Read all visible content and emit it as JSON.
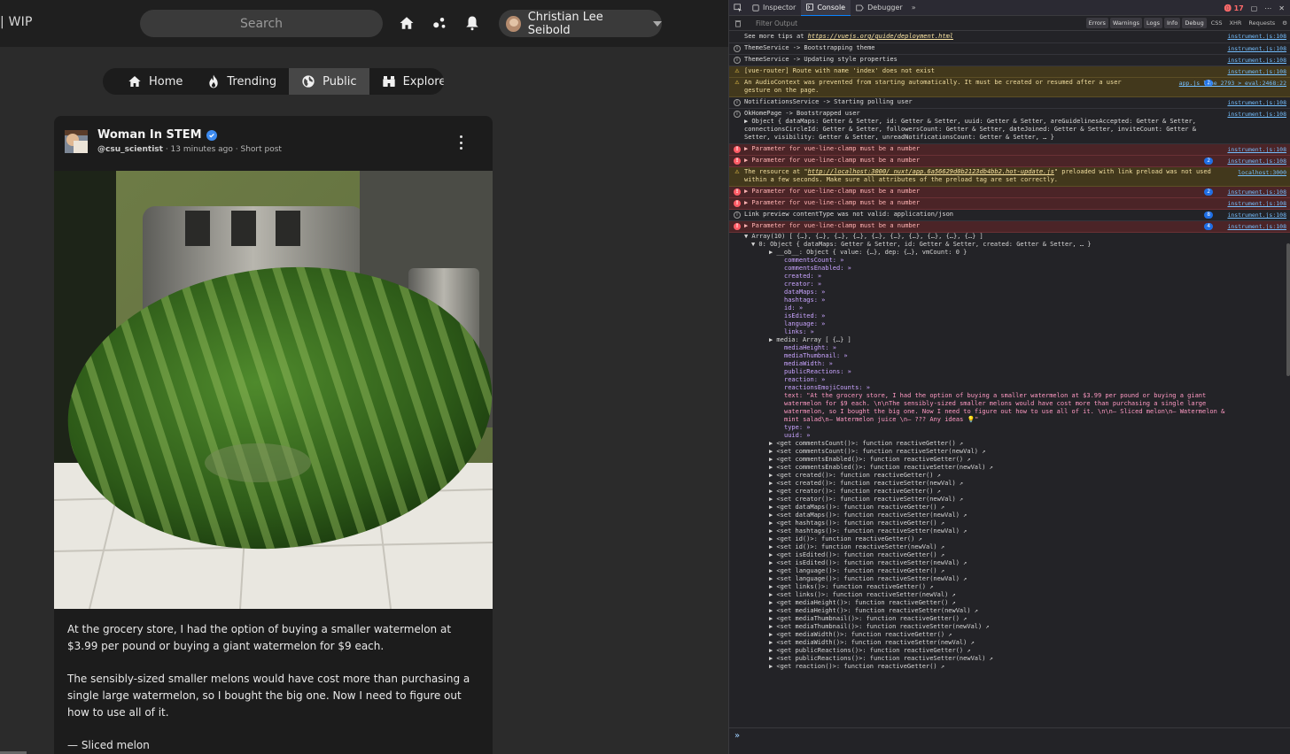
{
  "app": {
    "brand": "| WIP",
    "search": {
      "placeholder": "Search"
    },
    "user": {
      "name": "Christian Lee Seibold"
    },
    "tabs": [
      {
        "label": "Home",
        "icon": "home-icon",
        "active": false
      },
      {
        "label": "Trending",
        "icon": "flame-icon",
        "active": false
      },
      {
        "label": "Public",
        "icon": "globe-icon",
        "active": true
      },
      {
        "label": "Explore",
        "icon": "binoculars-icon",
        "active": false
      }
    ],
    "post": {
      "author": "Woman In STEM",
      "handle": "@csu_scientist",
      "time": "13 minutes ago",
      "post_type": "Short post",
      "paragraphs": [
        "At the grocery store, I had the option of buying a smaller watermelon at $3.99 per pound or buying a giant watermelon for $9 each.",
        "The sensibly-sized smaller melons would have cost more than purchasing a single large watermelon, so I bought the big one. Now I need to figure out how to use all of it.",
        "— Sliced melon"
      ]
    }
  },
  "devtools": {
    "tabs": [
      "Inspector",
      "Console",
      "Debugger"
    ],
    "error_count": "17",
    "filter_placeholder": "Filter Output",
    "filters": [
      "Errors",
      "Warnings",
      "Logs",
      "Info",
      "Debug",
      "CSS",
      "XHR",
      "Requests"
    ],
    "logs": [
      {
        "level": "plain",
        "pre": "See more tips at ",
        "link": "https://vuejs.org/guide/deployment.html",
        "post": "",
        "source": ""
      },
      {
        "level": "info",
        "text": "ThemeService -> Bootstrapping theme",
        "source": "instrument.js:108"
      },
      {
        "level": "info",
        "text": "ThemeService -> Updating style properties",
        "source": "instrument.js:108"
      },
      {
        "level": "warn",
        "text": "[vue-router] Route with name 'index' does not exist",
        "source": "instrument.js:108"
      },
      {
        "level": "warn",
        "text": "An AudioContext was prevented from starting automatically. It must be created or resumed after a user\ngesture on the page.",
        "count": "2",
        "source": "app.js line 2793 > eval:2468:22"
      },
      {
        "level": "info",
        "text": "NotificationsService -> Starting polling user",
        "source": "instrument.js:108"
      },
      {
        "level": "info",
        "text": "OkHomePage -> Bootstrapped user\n▶ Object { dataMaps: Getter & Setter, id: Getter & Setter, uuid: Getter & Setter, areGuidelinesAccepted: Getter & Setter,\nconnectionsCircleId: Getter & Setter, followersCount: Getter & Setter, dateJoined: Getter & Setter, inviteCount: Getter &\nSetter, visibility: Getter & Setter, unreadNotificationsCount: Getter & Setter, … }",
        "source": "instrument.js:108"
      },
      {
        "level": "err",
        "text": "▶ Parameter for vue-line-clamp must be a number",
        "source": "instrument.js:108"
      },
      {
        "level": "err",
        "text": "▶ Parameter for vue-line-clamp must be a number",
        "count": "2",
        "source": "instrument.js:108"
      },
      {
        "level": "warn",
        "pre": "The resource at \"",
        "link": "http://localhost:3000/_nuxt/app.6a56629d0b2123db4bb2.hot-update.js",
        "post": "\" preloaded with link preload was not used\nwithin a few seconds. Make sure all attributes of the preload tag are set correctly.",
        "source": "localhost:3000"
      },
      {
        "level": "err",
        "text": "▶ Parameter for vue-line-clamp must be a number",
        "count": "2",
        "source": "instrument.js:108"
      },
      {
        "level": "err",
        "text": "▶ Parameter for vue-line-clamp must be a number",
        "source": "instrument.js:108"
      },
      {
        "level": "info",
        "text": "Link preview contentType was not valid: application/json",
        "count": "8",
        "source": "instrument.js:108"
      },
      {
        "level": "err",
        "text": "▶ Parameter for vue-line-clamp must be a number",
        "count": "4",
        "source": "instrument.js:108"
      }
    ],
    "tree_source": "instrument.js:108",
    "tree": [
      {
        "lvl": 0,
        "text": "▼ Array(10) [ {…}, {…}, {…}, {…}, {…}, {…}, {…}, {…}, {…}, {…} ]"
      },
      {
        "lvl": 1,
        "text": "▼ 0: Object { dataMaps: Getter & Setter, id: Getter & Setter, created: Getter & Setter, … }"
      },
      {
        "lvl": 2,
        "text": "▶ __ob__: Object { value: {…}, dep: {…}, vmCount: 0 }"
      },
      {
        "lvl": 3,
        "text": "commentsCount: »"
      },
      {
        "lvl": 3,
        "text": "commentsEnabled: »"
      },
      {
        "lvl": 3,
        "text": "created: »"
      },
      {
        "lvl": 3,
        "text": "creator: »"
      },
      {
        "lvl": 3,
        "text": "dataMaps: »"
      },
      {
        "lvl": 3,
        "text": "hashtags: »"
      },
      {
        "lvl": 3,
        "text": "id: »"
      },
      {
        "lvl": 3,
        "text": "isEdited: »"
      },
      {
        "lvl": 3,
        "text": "language: »"
      },
      {
        "lvl": 3,
        "text": "links: »"
      },
      {
        "lvl": 2,
        "text": "▶ media: Array [ {…} ]"
      },
      {
        "lvl": 3,
        "text": "mediaHeight: »"
      },
      {
        "lvl": 3,
        "text": "mediaThumbnail: »"
      },
      {
        "lvl": 3,
        "text": "mediaWidth: »"
      },
      {
        "lvl": 3,
        "text": "publicReactions: »"
      },
      {
        "lvl": 3,
        "text": "reaction: »"
      },
      {
        "lvl": 3,
        "text": "reactionsEmojiCounts: »"
      },
      {
        "lvl": 3,
        "text": "text: \"At the grocery store, I had the option of buying a smaller watermelon at $3.99 per pound or buying a giant\nwatermelon for $9 each. \\n\\nThe sensibly-sized smaller melons would have cost more than purchasing a single large\nwatermelon, so I bought the big one. Now I need to figure out how to use all of it. \\n\\n— Sliced melon\\n— Watermelon &\nmint salad\\n— Watermelon juice \\n— ??? Any ideas 💡\""
      },
      {
        "lvl": 3,
        "text": "type: »"
      },
      {
        "lvl": 3,
        "text": "uuid: »"
      },
      {
        "lvl": 2,
        "text": "▶ <get commentsCount()>: function reactiveGetter() ↗"
      },
      {
        "lvl": 2,
        "text": "▶ <set commentsCount()>: function reactiveSetter(newVal) ↗"
      },
      {
        "lvl": 2,
        "text": "▶ <get commentsEnabled()>: function reactiveGetter() ↗"
      },
      {
        "lvl": 2,
        "text": "▶ <set commentsEnabled()>: function reactiveSetter(newVal) ↗"
      },
      {
        "lvl": 2,
        "text": "▶ <get created()>: function reactiveGetter() ↗"
      },
      {
        "lvl": 2,
        "text": "▶ <set created()>: function reactiveSetter(newVal) ↗"
      },
      {
        "lvl": 2,
        "text": "▶ <get creator()>: function reactiveGetter() ↗"
      },
      {
        "lvl": 2,
        "text": "▶ <set creator()>: function reactiveSetter(newVal) ↗"
      },
      {
        "lvl": 2,
        "text": "▶ <get dataMaps()>: function reactiveGetter() ↗"
      },
      {
        "lvl": 2,
        "text": "▶ <set dataMaps()>: function reactiveSetter(newVal) ↗"
      },
      {
        "lvl": 2,
        "text": "▶ <get hashtags()>: function reactiveGetter() ↗"
      },
      {
        "lvl": 2,
        "text": "▶ <set hashtags()>: function reactiveSetter(newVal) ↗"
      },
      {
        "lvl": 2,
        "text": "▶ <get id()>: function reactiveGetter() ↗"
      },
      {
        "lvl": 2,
        "text": "▶ <set id()>: function reactiveSetter(newVal) ↗"
      },
      {
        "lvl": 2,
        "text": "▶ <get isEdited()>: function reactiveGetter() ↗"
      },
      {
        "lvl": 2,
        "text": "▶ <set isEdited()>: function reactiveSetter(newVal) ↗"
      },
      {
        "lvl": 2,
        "text": "▶ <get language()>: function reactiveGetter() ↗"
      },
      {
        "lvl": 2,
        "text": "▶ <set language()>: function reactiveSetter(newVal) ↗"
      },
      {
        "lvl": 2,
        "text": "▶ <get links()>: function reactiveGetter() ↗"
      },
      {
        "lvl": 2,
        "text": "▶ <set links()>: function reactiveSetter(newVal) ↗"
      },
      {
        "lvl": 2,
        "text": "▶ <get mediaHeight()>: function reactiveGetter() ↗"
      },
      {
        "lvl": 2,
        "text": "▶ <set mediaHeight()>: function reactiveSetter(newVal) ↗"
      },
      {
        "lvl": 2,
        "text": "▶ <get mediaThumbnail()>: function reactiveGetter() ↗"
      },
      {
        "lvl": 2,
        "text": "▶ <set mediaThumbnail()>: function reactiveSetter(newVal) ↗"
      },
      {
        "lvl": 2,
        "text": "▶ <get mediaWidth()>: function reactiveGetter() ↗"
      },
      {
        "lvl": 2,
        "text": "▶ <set mediaWidth()>: function reactiveSetter(newVal) ↗"
      },
      {
        "lvl": 2,
        "text": "▶ <get publicReactions()>: function reactiveGetter() ↗"
      },
      {
        "lvl": 2,
        "text": "▶ <set publicReactions()>: function reactiveSetter(newVal) ↗"
      },
      {
        "lvl": 2,
        "text": "▶ <get reaction()>: function reactiveGetter() ↗"
      }
    ],
    "prompt": "»"
  }
}
